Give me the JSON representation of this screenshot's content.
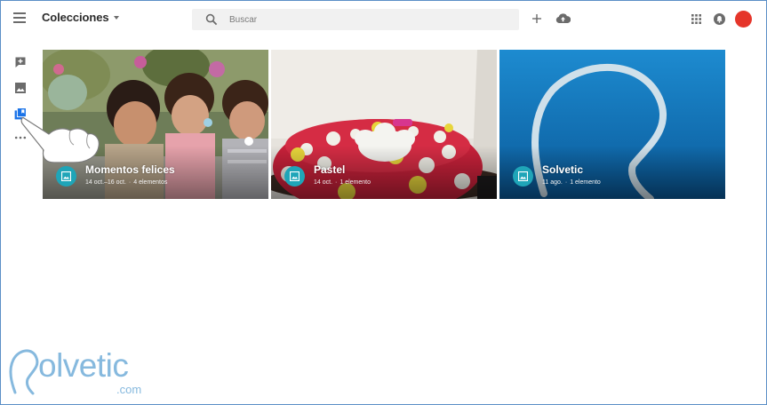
{
  "header": {
    "title": "Colecciones",
    "menu_icon": "menu-icon",
    "search": {
      "placeholder": "Buscar",
      "value": "",
      "icon": "search-icon"
    },
    "actions": [
      "add-icon",
      "upload-icon",
      "apps-icon",
      "notifications-icon"
    ],
    "avatar_color": "#e5352a"
  },
  "sidebar": {
    "items": [
      {
        "icon": "add-to-album-icon"
      },
      {
        "icon": "photo-icon"
      },
      {
        "icon": "collections-icon",
        "active": true
      },
      {
        "icon": "more-icon"
      }
    ]
  },
  "collections": [
    {
      "title": "Momentos felices",
      "date": "14 oct.–16 oct.",
      "count": "4 elementos"
    },
    {
      "title": "Pastel",
      "date": "14 oct.",
      "count": "1 elemento"
    },
    {
      "title": "Solvetic",
      "date": "11 ago.",
      "count": "1 elemento"
    }
  ],
  "watermark": {
    "text": "olvetic",
    "suffix": ".com"
  },
  "colors": {
    "accent": "#1fa5b8",
    "frame_border": "#5b8fc7",
    "watermark": "#86b9de"
  }
}
